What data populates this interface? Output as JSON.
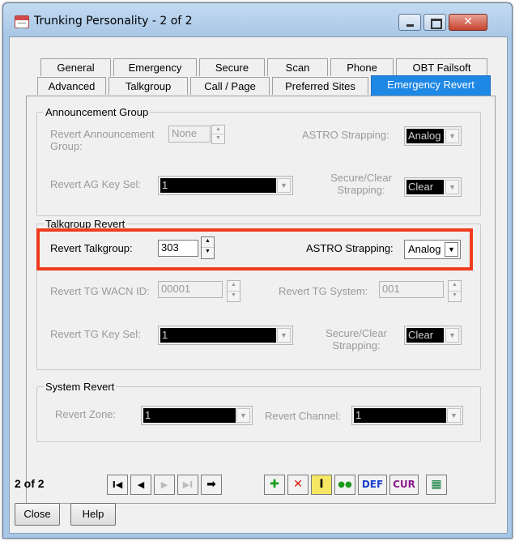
{
  "window": {
    "title": "Trunking Personality - 2 of 2",
    "close_glyph": "✕"
  },
  "tabs_row1": [
    "General",
    "Emergency",
    "Secure",
    "Scan",
    "Phone",
    "OBT Failsoft"
  ],
  "tabs_row2": [
    "Advanced",
    "Talkgroup",
    "Call / Page",
    "Preferred Sites",
    "Emergency Revert"
  ],
  "active_tab": "Emergency Revert",
  "announcement_group": {
    "title": "Announcement Group",
    "revert_ag_label": "Revert Announcement Group:",
    "revert_ag_value": "None",
    "astro_label": "ASTRO Strapping:",
    "astro_value": "Analog",
    "key_sel_label": "Revert AG Key Sel:",
    "key_sel_value": "1",
    "secure_clear_label": "Secure/Clear Strapping:",
    "secure_clear_value": "Clear"
  },
  "talkgroup_revert": {
    "title": "Talkgroup Revert",
    "revert_tg_label": "Revert Talkgroup:",
    "revert_tg_value": "303",
    "astro_label": "ASTRO Strapping:",
    "astro_value": "Analog",
    "wacn_label": "Revert TG WACN ID:",
    "wacn_value": "00001",
    "system_label": "Revert TG System:",
    "system_value": "001",
    "key_sel_label": "Revert TG Key Sel:",
    "key_sel_value": "1",
    "secure_clear_label": "Secure/Clear Strapping:",
    "secure_clear_value": "Clear"
  },
  "system_revert": {
    "title": "System Revert",
    "zone_label": "Revert Zone:",
    "zone_value": "1",
    "channel_label": "Revert Channel:",
    "channel_value": "1"
  },
  "toolbar": {
    "pager": "2 of 2",
    "first": "I◀",
    "prev": "◀",
    "next": "▶",
    "last": "▶I",
    "goto": "➡",
    "add": "✚",
    "delete": "✕",
    "insert": "I",
    "copy": "●●",
    "def": "DEF",
    "cur": "CUR",
    "grid": "▦"
  },
  "buttons": {
    "close": "Close",
    "help": "Help"
  },
  "colors": {
    "active_tab": "#1e88e5",
    "highlight": "#ef3b1e",
    "add_green": "#1a9a1a",
    "delete_red": "#e01010",
    "def_blue": "#1b3fd0",
    "cur_purple": "#8b1a8b"
  }
}
